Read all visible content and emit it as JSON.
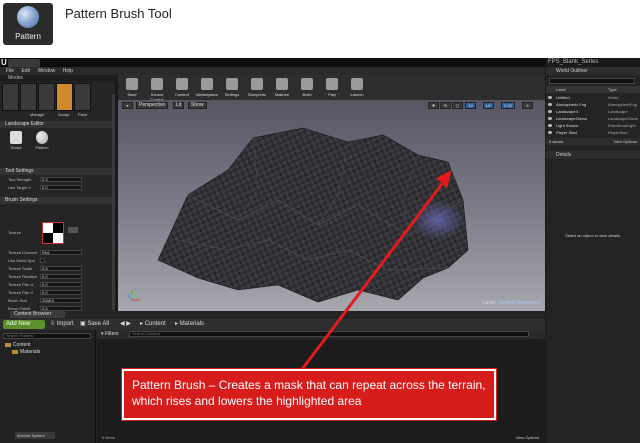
{
  "header": {
    "logo_label": "Pattern",
    "title": "Pattern Brush Tool"
  },
  "editor": {
    "tab_label": "",
    "project_name": "FPS_Blank_Series",
    "menu": [
      "File",
      "Edit",
      "Window",
      "Help"
    ],
    "modes_title": "Modes",
    "mode_labels": [
      "Manage",
      "Sculpt",
      "Paint"
    ],
    "landscape_title": "Landscape Editor",
    "tools": [
      "Sculpt",
      "Pattern"
    ],
    "tool_settings_title": "Tool Settings",
    "tool_settings": [
      {
        "label": "Tool Strength",
        "value": "0.3"
      },
      {
        "label": "Use Target V",
        "value": "0.0"
      }
    ],
    "brush_settings_title": "Brush Settings",
    "texture_label": "Texture",
    "brush_settings": [
      {
        "label": "Texture Channel",
        "value": "Red"
      },
      {
        "label": "Use World Spa",
        "value": ""
      },
      {
        "label": "Texture Scale",
        "value": "0.5"
      },
      {
        "label": "Texture Rotation",
        "value": "0.0"
      },
      {
        "label": "Texture Pan U",
        "value": "0.0"
      },
      {
        "label": "Texture Pan V",
        "value": "0.0"
      },
      {
        "label": "Brush Size",
        "value": "2048.0"
      },
      {
        "label": "Brush Falloff",
        "value": "0.5"
      },
      {
        "label": "Use Clay Brush",
        "value": ""
      }
    ],
    "toolbar": [
      "Save",
      "Source Control",
      "Content",
      "Marketplace",
      "Settings",
      "Blueprints",
      "Matinee",
      "Build",
      "Play",
      "Launch"
    ],
    "viewport": {
      "perspective": "Perspective",
      "lit": "Lit",
      "show": "Show",
      "snap_values": [
        "10",
        "10°",
        "0.25",
        "4"
      ],
      "level_label": "Level:",
      "level_name": "Untitled (Persistent)"
    },
    "outliner": {
      "title": "World Outliner",
      "col_label": "Label",
      "col_type": "Type",
      "rows": [
        {
          "name": "Untitled",
          "type": "World"
        },
        {
          "name": "Atmospheric Fog",
          "type": "AtmosphericFog"
        },
        {
          "name": "Landscape4",
          "type": "Landscape"
        },
        {
          "name": "LandscapeGizmo",
          "type": "LandscapeGizmo"
        },
        {
          "name": "Light Source",
          "type": "DirectionalLight"
        },
        {
          "name": "Player Start",
          "type": "PlayerStart"
        }
      ],
      "count": "6 actors",
      "view_options": "View Options"
    },
    "details": {
      "title": "Details",
      "message": "Select an object to view details."
    },
    "content_browser": {
      "tab": "Content Browser",
      "add_new": "Add New",
      "import": "Import",
      "save_all": "Save All",
      "path": [
        "Content",
        "Materials"
      ],
      "tree_search": "Search Folders",
      "tree_items": [
        "Content",
        "Materials"
      ],
      "filters": "Filters",
      "search": "Search Content",
      "items": "0 items",
      "view_options": "View Options"
    },
    "bottom_tab": "Internal System"
  },
  "callout": {
    "text": "Pattern Brush – Creates a mask that can repeat across the terrain, which rises and lowers the highlighted area"
  },
  "colors": {
    "accent_red": "#d71c1c",
    "active_mode": "#d08a2c",
    "add_new_green": "#5b8f2b"
  }
}
